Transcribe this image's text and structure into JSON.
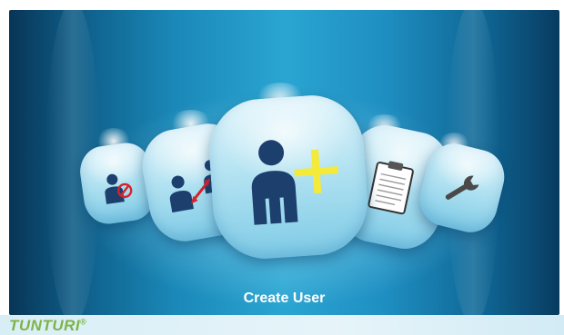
{
  "menu": {
    "selected_label": "Create User",
    "items": [
      {
        "name": "delete-user",
        "icon": "delete-user-icon"
      },
      {
        "name": "switch-user",
        "icon": "switch-user-icon"
      },
      {
        "name": "create-user",
        "icon": "create-user-icon"
      },
      {
        "name": "history",
        "icon": "clipboard-icon"
      },
      {
        "name": "settings",
        "icon": "wrench-icon"
      }
    ]
  },
  "brand": {
    "logo_text": "TUNTURI",
    "registered": "®",
    "accent": "#7fb347"
  },
  "colors": {
    "background": "#1a88b8",
    "icon_figure": "#1c3f6e",
    "plus": "#f3ea3a",
    "arrow": "#d8222a"
  }
}
